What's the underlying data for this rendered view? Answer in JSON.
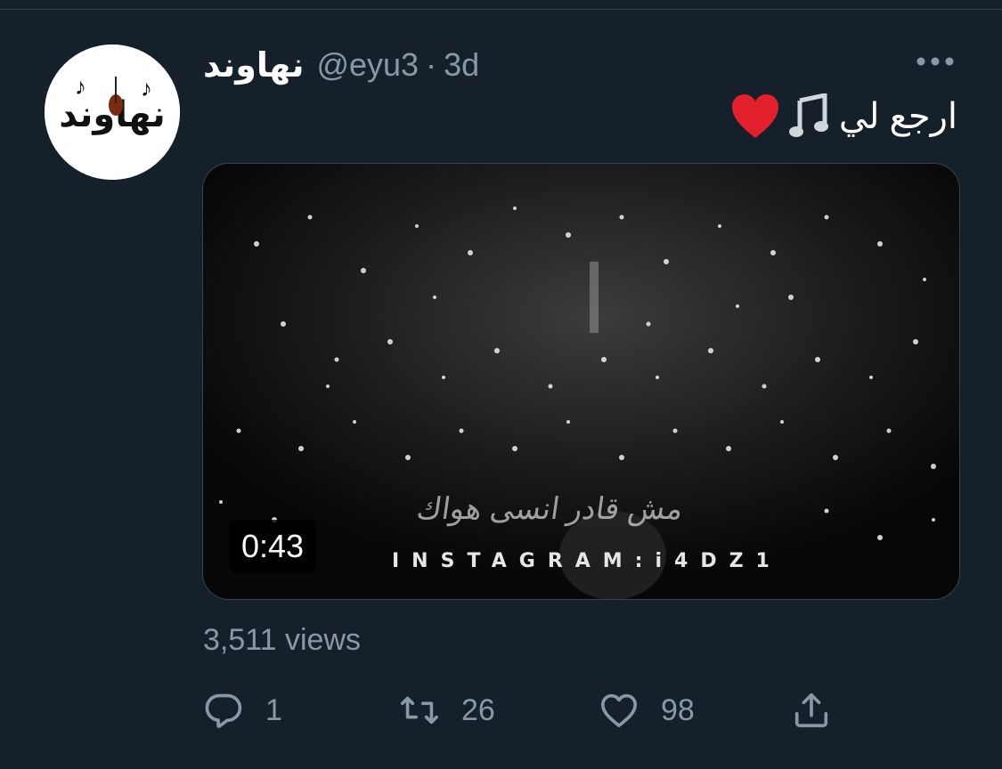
{
  "tweet": {
    "display_name": "نهاوند",
    "handle": "@eyu3",
    "separator": "·",
    "time": "3d",
    "text": "ارجع لي",
    "avatar_text": "نهاوند",
    "media": {
      "duration": "0:43",
      "watermark": "INSTAGRAM:i4DZ1",
      "overlay_text": "مش قادر انسى هواك"
    },
    "views": "3,511 views",
    "actions": {
      "reply_count": "1",
      "retweet_count": "26",
      "like_count": "98"
    }
  },
  "colors": {
    "background": "#15202b",
    "secondary_text": "#8899a6",
    "divider": "#38444d"
  },
  "icons": [
    "more-icon",
    "music-note-icon",
    "heart-emoji-icon",
    "reply-icon",
    "retweet-icon",
    "like-icon",
    "share-icon"
  ]
}
